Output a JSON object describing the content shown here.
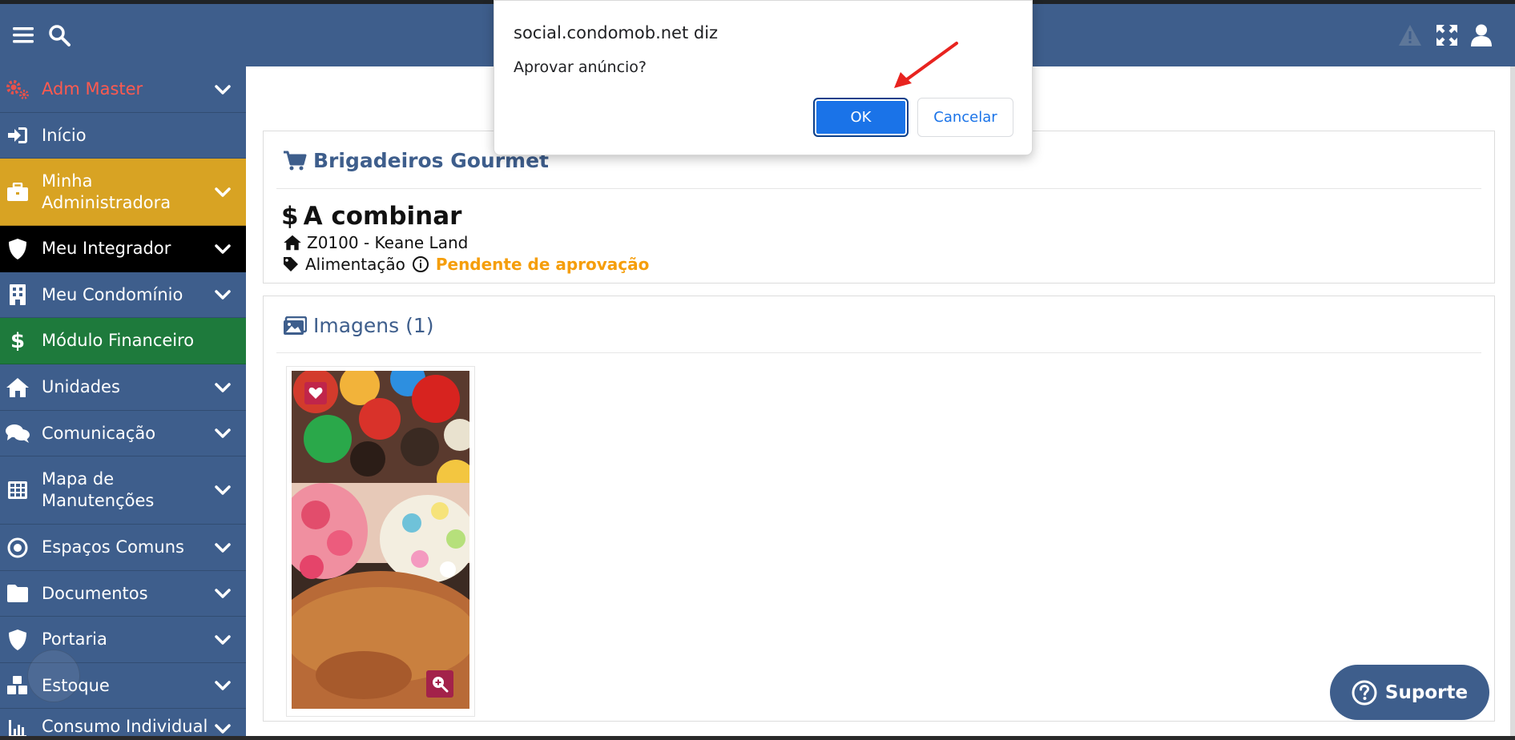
{
  "dialog": {
    "origin": "social.condomob.net diz",
    "message": "Aprovar anúncio?",
    "ok_label": "OK",
    "cancel_label": "Cancelar"
  },
  "header": {
    "icons": [
      "menu-icon",
      "search-icon",
      "warning-icon",
      "expand-icon",
      "user-icon"
    ],
    "color": "#3e5e8c"
  },
  "sidebar": {
    "items": [
      {
        "label": "Adm Master",
        "icon": "gears-icon",
        "bg": "#3e5e8c",
        "color": "#ff5a4f",
        "chevron": true
      },
      {
        "label": "Início",
        "icon": "sign-in-icon",
        "bg": "#3e5e8c",
        "color": "#ffffff",
        "chevron": false
      },
      {
        "label": "Minha Administradora",
        "icon": "briefcase-icon",
        "bg": "#d8a323",
        "color": "#ffffff",
        "chevron": true
      },
      {
        "label": "Meu Integrador",
        "icon": "shield-icon",
        "bg": "#000000",
        "color": "#ffffff",
        "chevron": true
      },
      {
        "label": "Meu Condomínio",
        "icon": "building-icon",
        "bg": "#3e5e8c",
        "color": "#ffffff",
        "chevron": true
      },
      {
        "label": "Módulo Financeiro",
        "icon": "dollar-icon",
        "bg": "#1e7a3c",
        "color": "#ffffff",
        "chevron": false
      },
      {
        "label": "Unidades",
        "icon": "home-icon",
        "bg": "#3e5e8c",
        "color": "#ffffff",
        "chevron": true
      },
      {
        "label": "Comunicação",
        "icon": "comments-icon",
        "bg": "#3e5e8c",
        "color": "#ffffff",
        "chevron": true
      },
      {
        "label": "Mapa de Manutenções",
        "icon": "grid-icon",
        "bg": "#3e5e8c",
        "color": "#ffffff",
        "chevron": true
      },
      {
        "label": "Espaços Comuns",
        "icon": "dot-circle-icon",
        "bg": "#3e5e8c",
        "color": "#ffffff",
        "chevron": true
      },
      {
        "label": "Documentos",
        "icon": "folder-icon",
        "bg": "#3e5e8c",
        "color": "#ffffff",
        "chevron": true
      },
      {
        "label": "Portaria",
        "icon": "shield-icon",
        "bg": "#3e5e8c",
        "color": "#ffffff",
        "chevron": true
      },
      {
        "label": "Estoque",
        "icon": "cubes-icon",
        "bg": "#3e5e8c",
        "color": "#ffffff",
        "chevron": true
      },
      {
        "label": "Consumo Individual",
        "icon": "chart-icon",
        "bg": "#3e5e8c",
        "color": "#ffffff",
        "chevron": true
      }
    ]
  },
  "listing": {
    "title": "Brigadeiros Gourmet",
    "price": "A combinar",
    "location": "Z0100 - Keane Land",
    "category": "Alimentação",
    "status": "Pendente de aprovação",
    "status_color": "#f59e0b"
  },
  "images": {
    "title": "Imagens (1)"
  },
  "support": {
    "label": "Suporte"
  }
}
